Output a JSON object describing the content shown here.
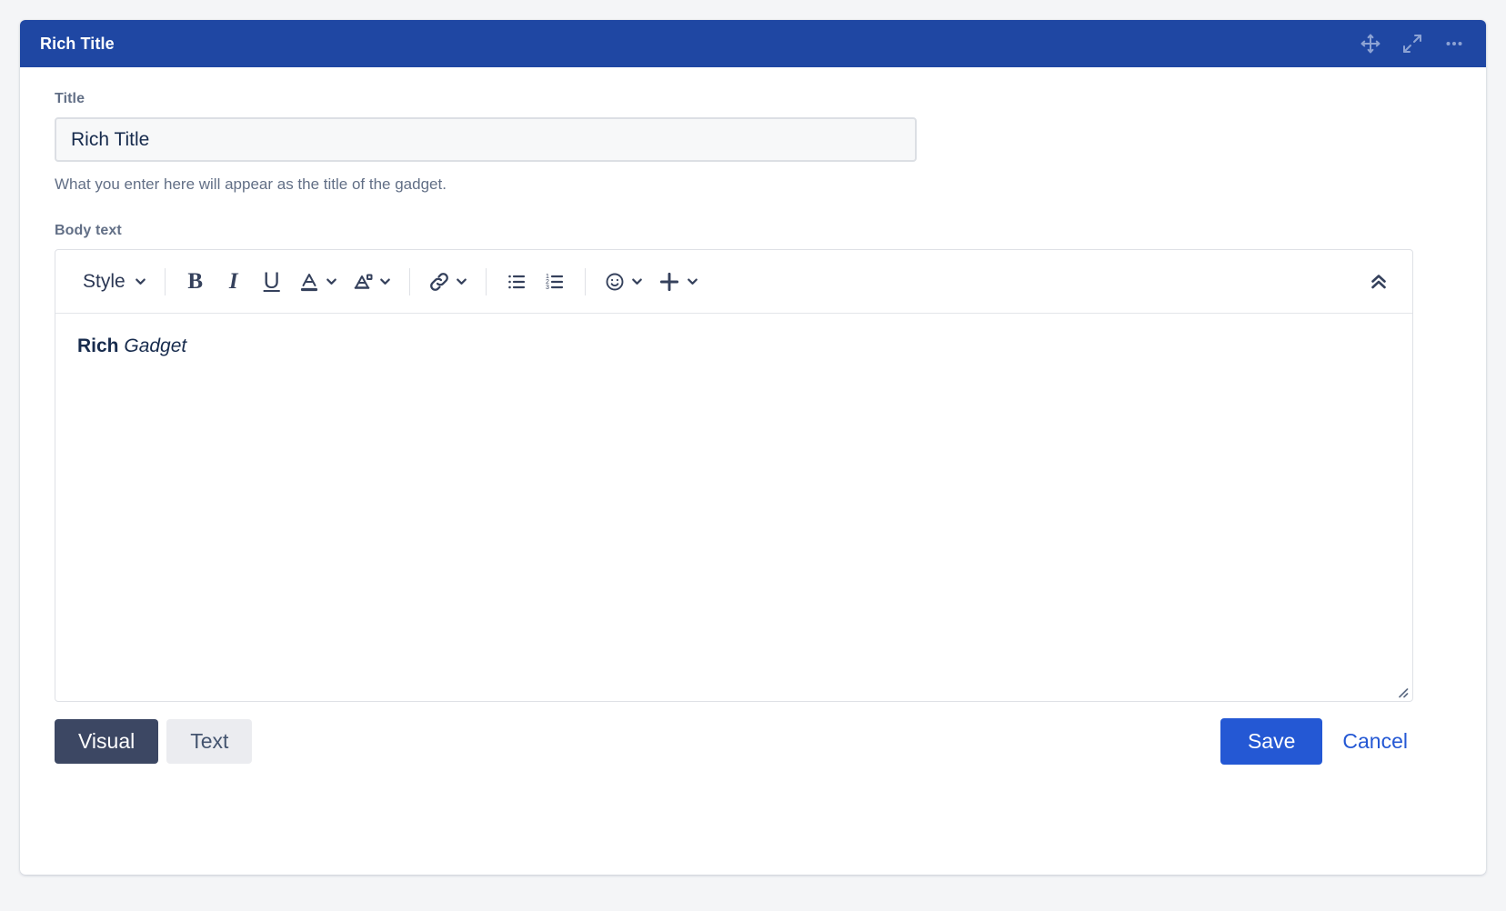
{
  "header": {
    "title": "Rich Title",
    "icons": [
      {
        "name": "move-icon",
        "label": "Move gadget"
      },
      {
        "name": "expand-icon",
        "label": "Maximize gadget"
      },
      {
        "name": "more-options-icon",
        "label": "More options"
      }
    ]
  },
  "form": {
    "title_label": "Title",
    "title_value": "Rich Title",
    "title_placeholder": "Rich Title",
    "title_hint": "What you enter here will appear as the title of the gadget.",
    "body_label": "Body text"
  },
  "toolbar": {
    "style_label": "Style",
    "buttons": [
      {
        "name": "style-dropdown",
        "label": "Style"
      },
      {
        "name": "bold-button",
        "label": "B"
      },
      {
        "name": "italic-button",
        "label": "I"
      },
      {
        "name": "underline-button",
        "label": "U"
      },
      {
        "name": "text-color-button",
        "label": "A"
      },
      {
        "name": "text-highlight-button",
        "label": "A"
      },
      {
        "name": "link-button",
        "label": "Link"
      },
      {
        "name": "bullet-list-button",
        "label": "Bulleted list"
      },
      {
        "name": "numbered-list-button",
        "label": "Numbered list"
      },
      {
        "name": "emoji-button",
        "label": "Emoji"
      },
      {
        "name": "insert-button",
        "label": "Insert"
      },
      {
        "name": "collapse-toolbar-button",
        "label": "Collapse toolbar"
      }
    ]
  },
  "editor": {
    "content_bold": "Rich",
    "content_italic": "Gadget"
  },
  "footer": {
    "visual_label": "Visual",
    "text_label": "Text",
    "save_label": "Save",
    "cancel_label": "Cancel"
  },
  "colors": {
    "header_blue": "#1f47a3",
    "primary_blue": "#2458d4",
    "dark_slate": "#3c4763",
    "page_bg": "#f4f5f7",
    "label_gray": "#626f86"
  }
}
